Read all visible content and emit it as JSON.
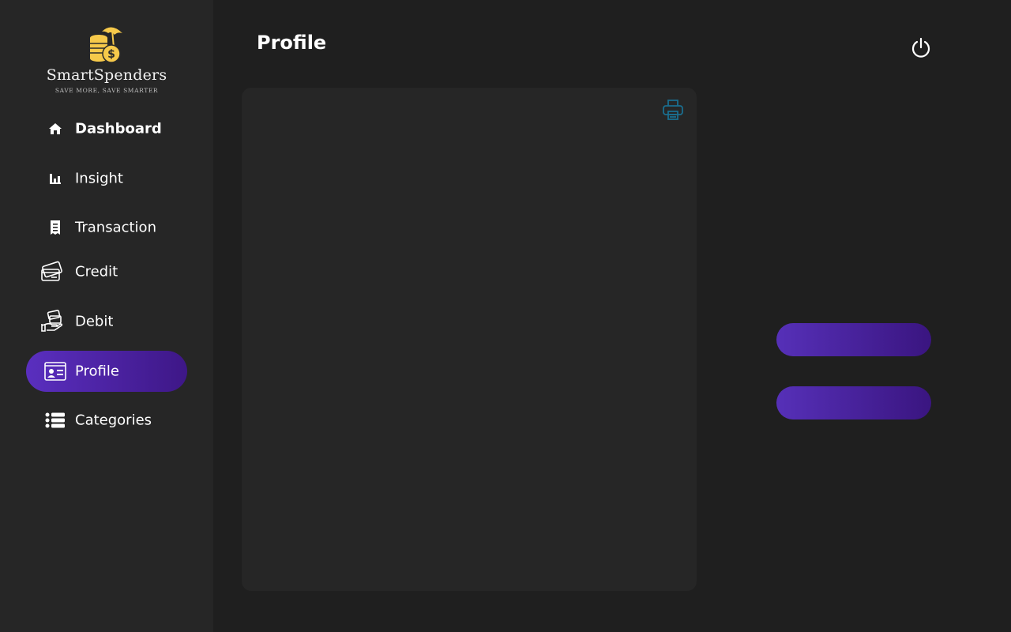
{
  "brand": {
    "name": "SmartSpenders",
    "tagline": "SAVE MORE, SAVE SMARTER",
    "logo_colors": {
      "coin": "#f6c94a",
      "dark": "#2a2a2a"
    }
  },
  "sidebar": {
    "items": [
      {
        "label": "Dashboard",
        "icon": "home-icon"
      },
      {
        "label": "Insight",
        "icon": "bar-chart-icon"
      },
      {
        "label": "Transaction",
        "icon": "receipt-icon"
      },
      {
        "label": "Credit",
        "icon": "credit-card-icon"
      },
      {
        "label": "Debit",
        "icon": "hand-card-icon"
      },
      {
        "label": "Profile",
        "icon": "profile-card-icon",
        "active": true
      },
      {
        "label": "Categories",
        "icon": "list-icon"
      }
    ]
  },
  "header": {
    "title": "Profile",
    "power_icon": "power-icon"
  },
  "card": {
    "print_icon": "printer-icon",
    "print_icon_color": "#1a6e8f"
  },
  "actions": {
    "button_1_label": "",
    "button_2_label": ""
  },
  "colors": {
    "background": "#1f1f1f",
    "sidebar": "#262626",
    "card": "#262626",
    "accent_start": "#5a2fbf",
    "accent_end": "#3e1787"
  }
}
